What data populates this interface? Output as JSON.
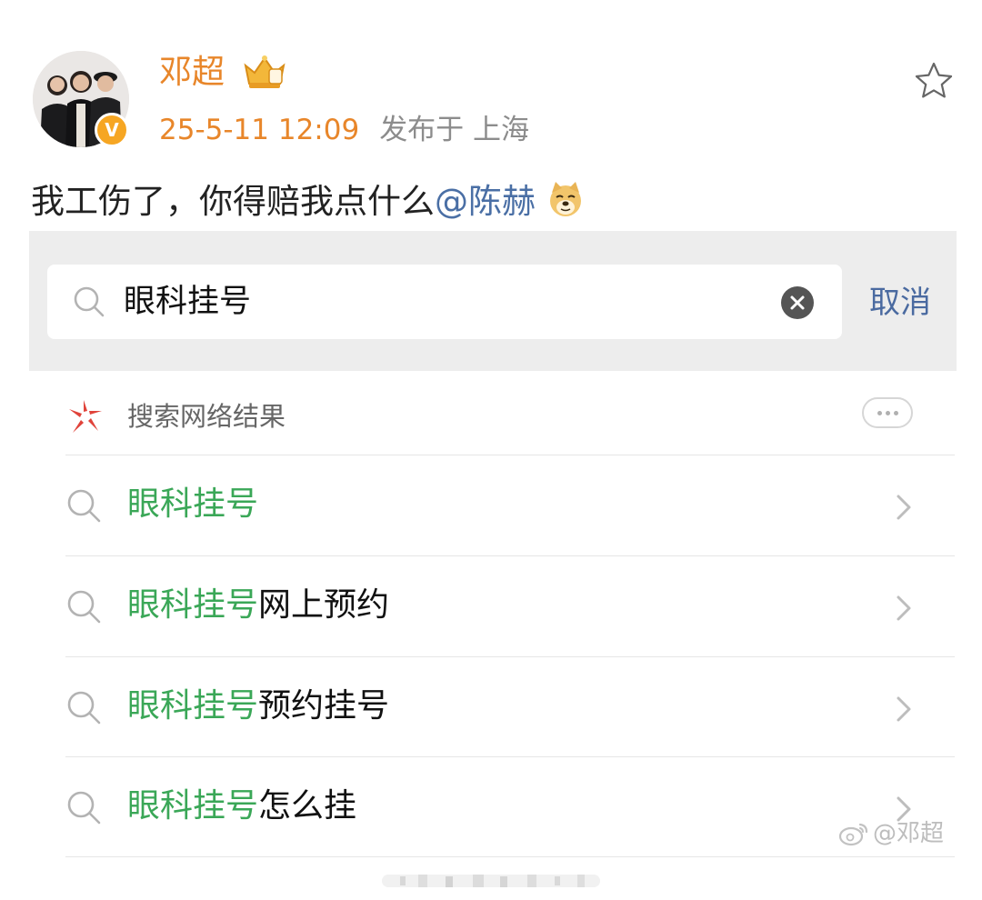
{
  "post": {
    "username": "邓超",
    "timestamp": "25-5-11 12:09",
    "location": "发布于 上海",
    "verified_badge": "V",
    "text": "我工伤了，你得赔我点什么",
    "mention": "@陈赫",
    "icons": {
      "avatar": "avatar-photo",
      "crown": "vip-crown-icon",
      "favorite": "star-icon",
      "emoji": "doge-emoji"
    },
    "colors": {
      "name": "#e8862a",
      "mention": "#4a6fa5"
    }
  },
  "search": {
    "query": "眼科挂号",
    "cancel_label": "取消",
    "web_section_label": "搜索网络结果",
    "highlight_color": "#3aa757",
    "suggestions": [
      {
        "highlight": "眼科挂号",
        "rest": ""
      },
      {
        "highlight": "眼科挂号",
        "rest": "网上预约"
      },
      {
        "highlight": "眼科挂号",
        "rest": "预约挂号"
      },
      {
        "highlight": "眼科挂号",
        "rest": "怎么挂"
      }
    ]
  },
  "watermark": {
    "text": "@邓超"
  }
}
